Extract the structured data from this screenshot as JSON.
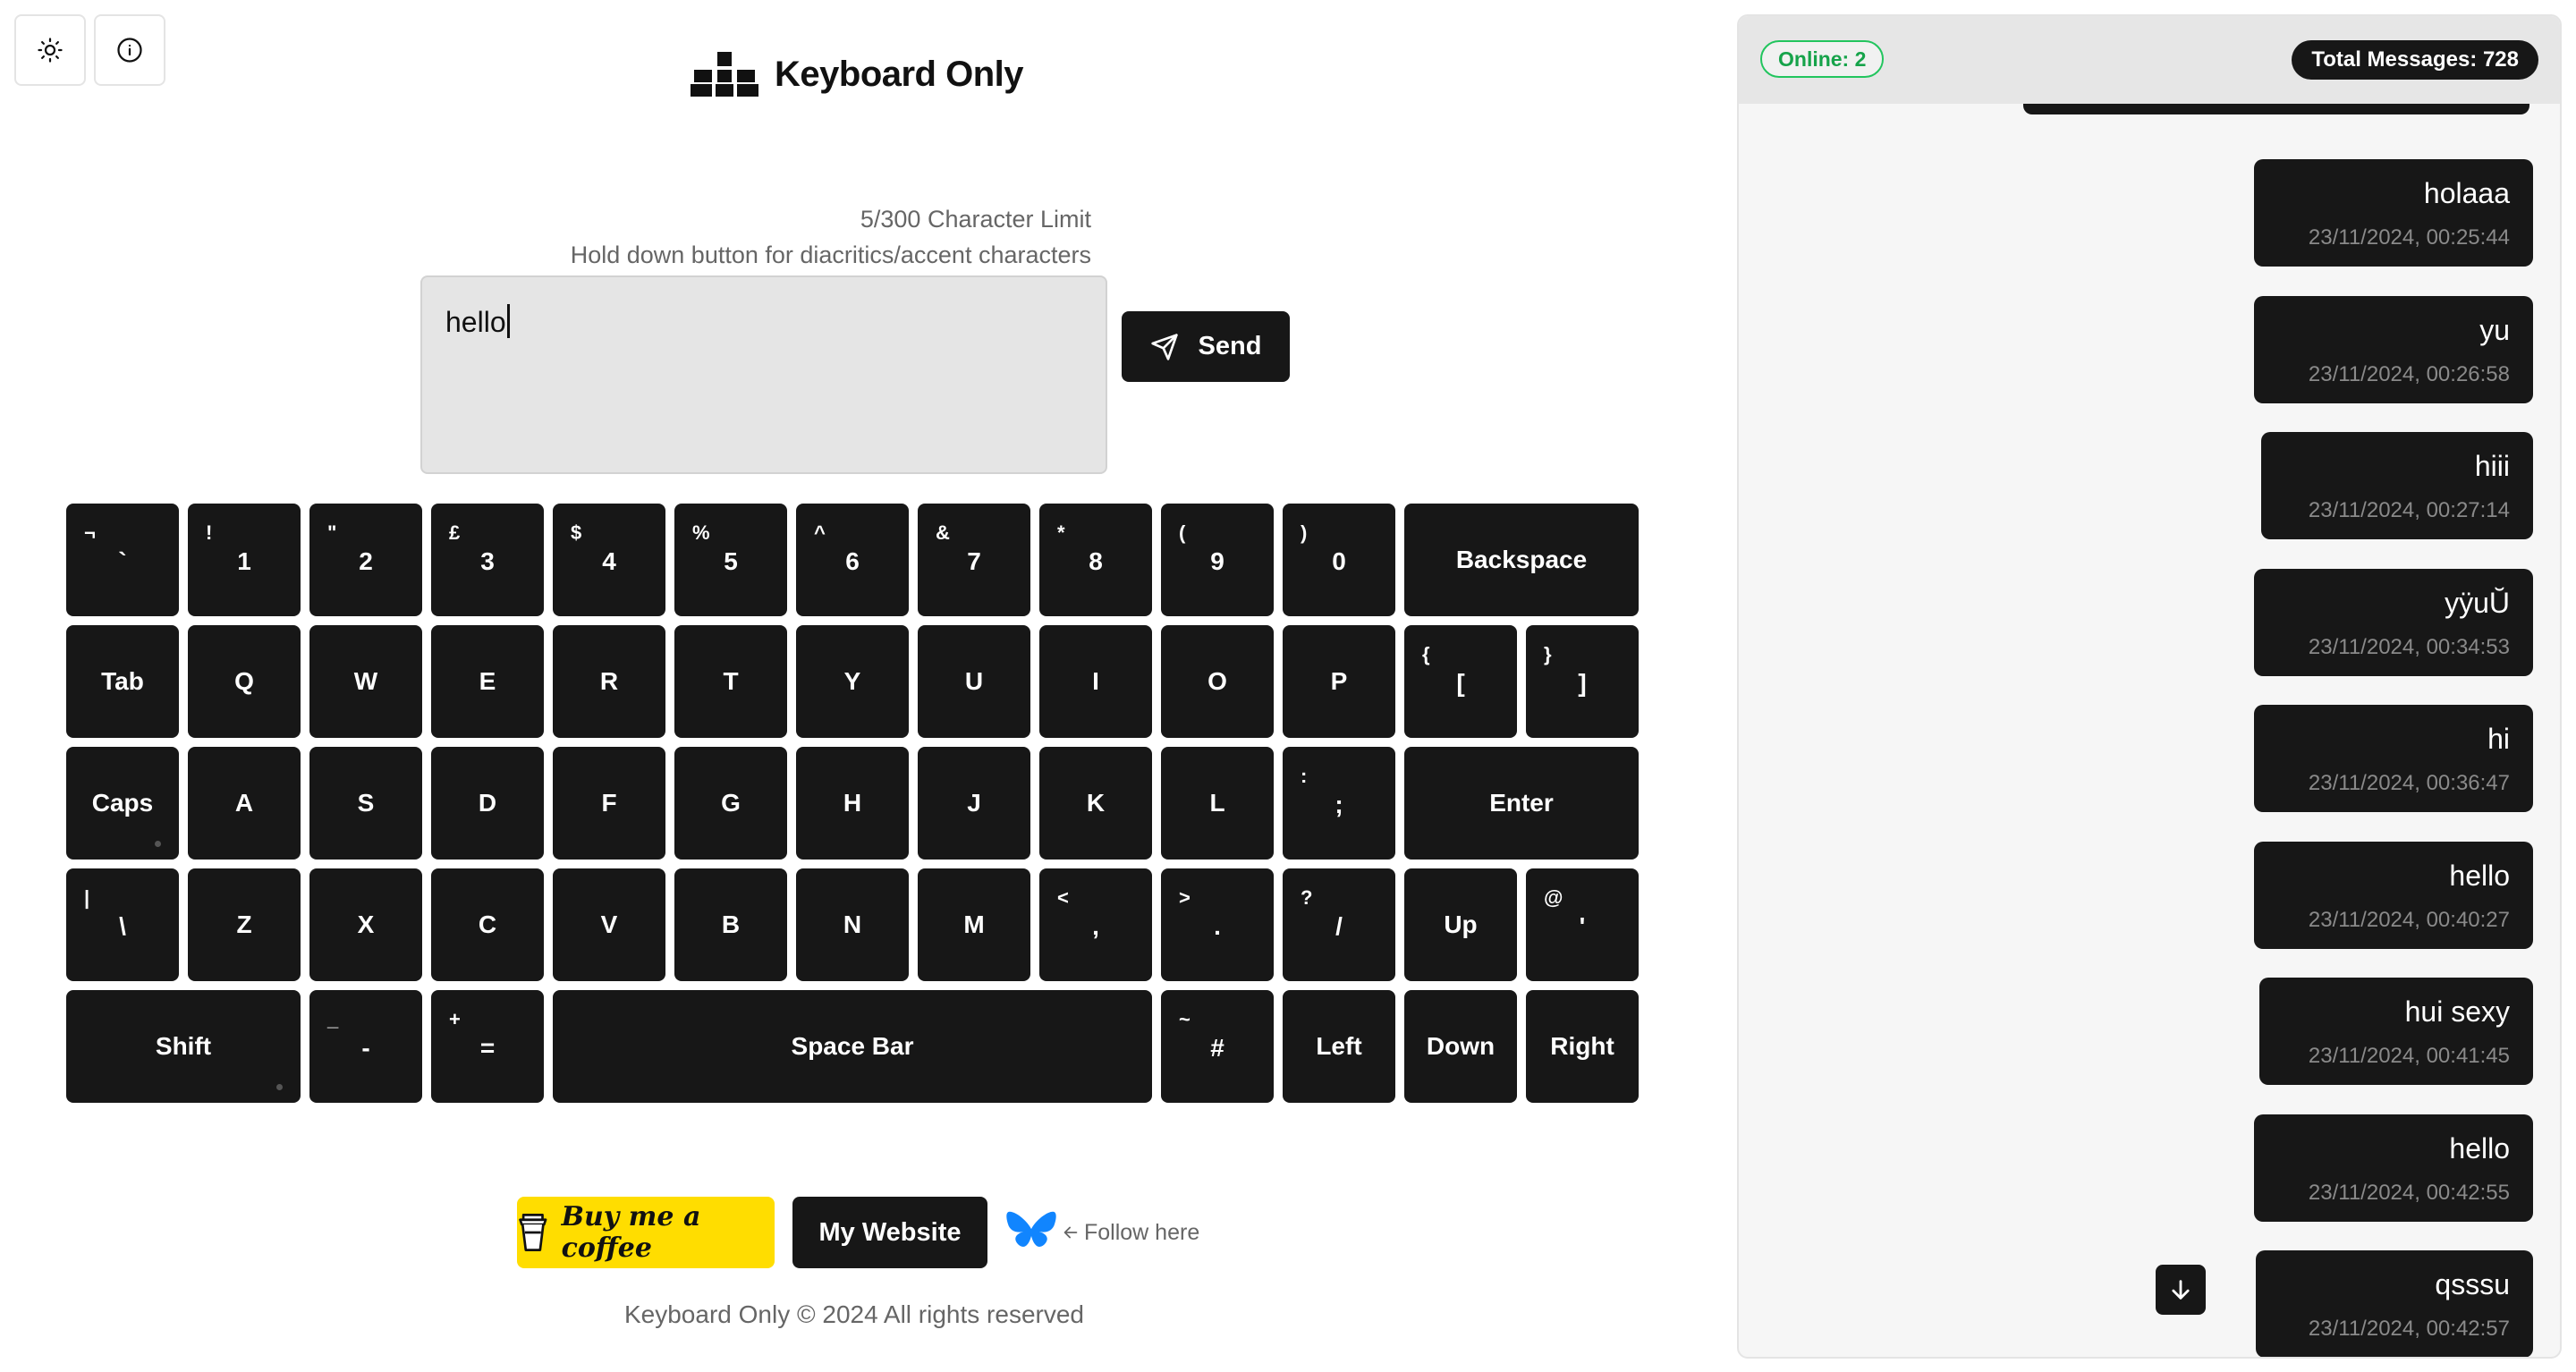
{
  "header": {
    "title": "Keyboard Only",
    "theme_icon": "sun-icon",
    "info_icon": "info-icon",
    "logo_icon": "keyboard-blocks-icon"
  },
  "composer": {
    "char_limit": "5/300 Character Limit",
    "hint": "Hold down button for diacritics/accent characters",
    "value": "hello",
    "send_label": "Send",
    "send_icon": "paper-plane-icon"
  },
  "keyboard": {
    "rows": [
      [
        {
          "main": "`",
          "shift": "¬"
        },
        {
          "main": "1",
          "shift": "!"
        },
        {
          "main": "2",
          "shift": "\""
        },
        {
          "main": "3",
          "shift": "£"
        },
        {
          "main": "4",
          "shift": "$"
        },
        {
          "main": "5",
          "shift": "%"
        },
        {
          "main": "6",
          "shift": "^"
        },
        {
          "main": "7",
          "shift": "&"
        },
        {
          "main": "8",
          "shift": "*"
        },
        {
          "main": "9",
          "shift": "("
        },
        {
          "main": "0",
          "shift": ")"
        },
        {
          "main": "Backspace"
        }
      ],
      [
        {
          "main": "Tab"
        },
        {
          "main": "Q"
        },
        {
          "main": "W"
        },
        {
          "main": "E"
        },
        {
          "main": "R"
        },
        {
          "main": "T"
        },
        {
          "main": "Y"
        },
        {
          "main": "U"
        },
        {
          "main": "I"
        },
        {
          "main": "O"
        },
        {
          "main": "P"
        },
        {
          "main": "[",
          "shift": "{"
        },
        {
          "main": "]",
          "shift": "}"
        }
      ],
      [
        {
          "main": "Caps"
        },
        {
          "main": "A"
        },
        {
          "main": "S"
        },
        {
          "main": "D"
        },
        {
          "main": "F"
        },
        {
          "main": "G"
        },
        {
          "main": "H"
        },
        {
          "main": "J"
        },
        {
          "main": "K"
        },
        {
          "main": "L"
        },
        {
          "main": ";",
          "shift": ":"
        },
        {
          "main": "Enter"
        }
      ],
      [
        {
          "main": "\\",
          "shift": "|"
        },
        {
          "main": "Z"
        },
        {
          "main": "X"
        },
        {
          "main": "C"
        },
        {
          "main": "V"
        },
        {
          "main": "B"
        },
        {
          "main": "N"
        },
        {
          "main": "M"
        },
        {
          "main": ",",
          "shift": "<"
        },
        {
          "main": ".",
          "shift": ">"
        },
        {
          "main": "/",
          "shift": "?"
        },
        {
          "main": "Up"
        },
        {
          "main": "'",
          "shift": "@"
        }
      ],
      [
        {
          "main": "Shift"
        },
        {
          "main": "-",
          "shift": "_"
        },
        {
          "main": "=",
          "shift": "+"
        },
        {
          "main": "Space Bar"
        },
        {
          "main": "#",
          "shift": "~"
        },
        {
          "main": "Left"
        },
        {
          "main": "Down"
        },
        {
          "main": "Right"
        }
      ]
    ]
  },
  "footer": {
    "coffee_label": "Buy me a coffee",
    "coffee_icon": "coffee-cup-icon",
    "website_label": "My Website",
    "bluesky_icon": "butterfly-icon",
    "follow_label": "Follow here",
    "arrow_icon": "arrow-left-icon",
    "copyright": "Keyboard Only © 2024 All rights reserved"
  },
  "chat": {
    "online": "Online: 2",
    "total": "Total Messages: 728",
    "scroll_icon": "arrow-down-icon",
    "messages": [
      {
        "text": "holaaa",
        "time": "23/11/2024, 00:25:44"
      },
      {
        "text": "yu",
        "time": "23/11/2024, 00:26:58"
      },
      {
        "text": "hiii",
        "time": "23/11/2024, 00:27:14"
      },
      {
        "text": "yÿuŬ",
        "time": "23/11/2024, 00:34:53"
      },
      {
        "text": "hi",
        "time": "23/11/2024, 00:36:47"
      },
      {
        "text": "hello",
        "time": "23/11/2024, 00:40:27"
      },
      {
        "text": "hui sexy",
        "time": "23/11/2024, 00:41:45"
      },
      {
        "text": "hello",
        "time": "23/11/2024, 00:42:55"
      },
      {
        "text": "qsssu",
        "time": "23/11/2024, 00:42:57"
      }
    ]
  }
}
